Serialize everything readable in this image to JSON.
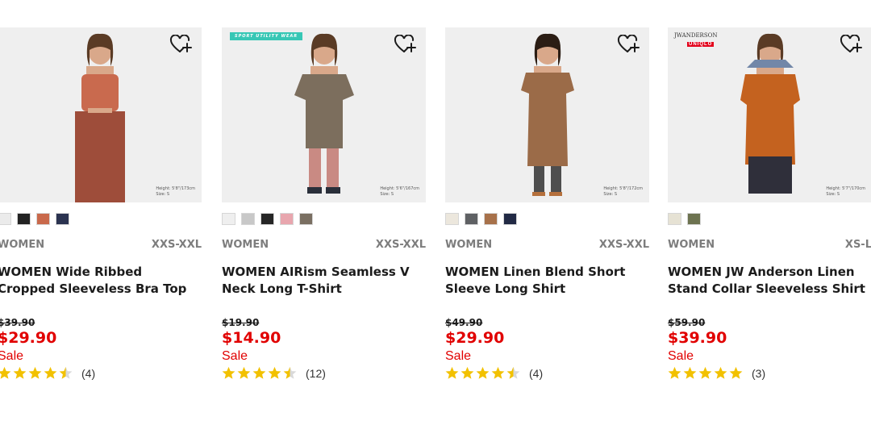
{
  "products": [
    {
      "name": "WOMEN Wide Ribbed Cropped Sleeveless Bra Top",
      "gender": "WOMEN",
      "sizes": "XXS-XXL",
      "original_price": "$39.90",
      "sale_price": "$29.90",
      "sale_label": "Sale",
      "rating": 4.5,
      "reviews": "(4)",
      "model_info": [
        "Height: 5'8\"/173cm",
        "Size: S"
      ],
      "colors": [
        "#ebebeb",
        "#232323",
        "#c9694b",
        "#2b3350"
      ],
      "garment_color": "#c96a4e",
      "bottom_color": "#9e4d3a"
    },
    {
      "name": "WOMEN AIRism Seamless V Neck Long T-Shirt",
      "gender": "WOMEN",
      "sizes": "XXS-XXL",
      "original_price": "$19.90",
      "sale_price": "$14.90",
      "sale_label": "Sale",
      "rating": 4.5,
      "reviews": "(12)",
      "badge": "SPORT UTILITY WEAR",
      "model_info": [
        "Height: 5'6\"/167cm",
        "Size: S"
      ],
      "colors": [
        "#efefef",
        "#c8c8c8",
        "#262626",
        "#e8a6ae",
        "#7a6f62"
      ],
      "garment_color": "#7c6e5d",
      "bottom_color": "#c98a83"
    },
    {
      "name": "WOMEN Linen Blend Short Sleeve Long Shirt",
      "gender": "WOMEN",
      "sizes": "XXS-XXL",
      "original_price": "$49.90",
      "sale_price": "$29.90",
      "sale_label": "Sale",
      "rating": 4.5,
      "reviews": "(4)",
      "model_info": [
        "Height: 5'8\"/172cm",
        "Size: S"
      ],
      "colors": [
        "#ece7dd",
        "#5f6164",
        "#a7714a",
        "#222a45"
      ],
      "garment_color": "#9b6b48",
      "bottom_color": "#4e4e4e"
    },
    {
      "name": "WOMEN JW Anderson Linen Stand Collar Sleeveless Shirt",
      "gender": "WOMEN",
      "sizes": "XS-L",
      "original_price": "$59.90",
      "sale_price": "$39.90",
      "sale_label": "Sale",
      "rating": 5,
      "reviews": "(3)",
      "collab_logo": "JWANDERSON",
      "collab_brand": "UNIQLO",
      "model_info": [
        "Height: 5'7\"/170cm",
        "Size: S"
      ],
      "colors": [
        "#e6e2d4",
        "#6d7350"
      ],
      "garment_color": "#c4621f",
      "bottom_color": "#2f2f3a"
    }
  ],
  "icons": {
    "favorite": "heart-plus-icon",
    "star": "star-icon"
  },
  "theme": {
    "sale_color": "#e10000",
    "star_color": "#f2c100"
  }
}
